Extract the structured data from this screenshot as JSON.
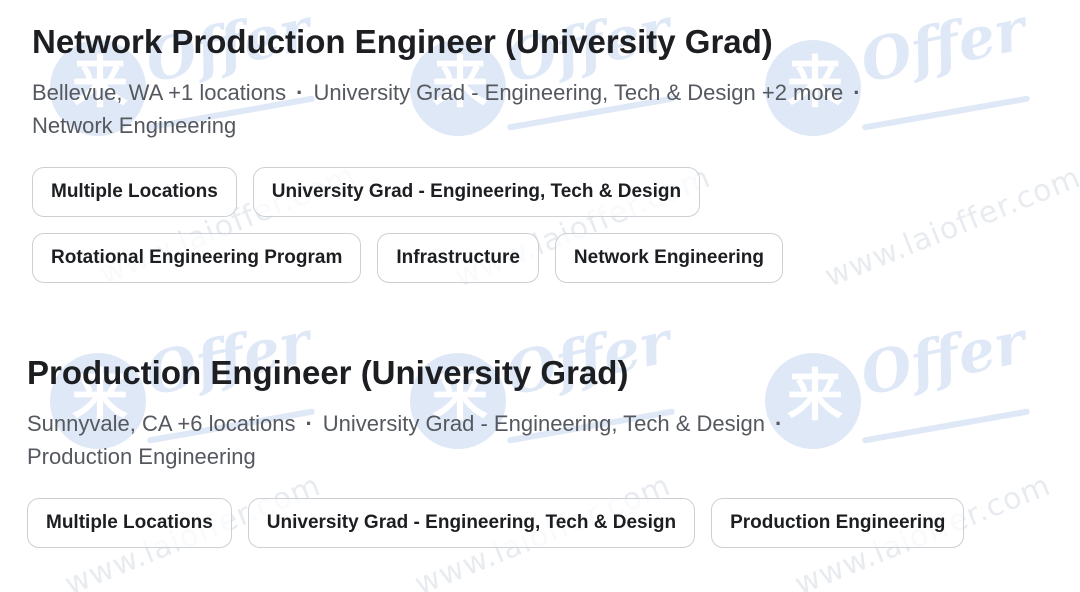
{
  "jobs": [
    {
      "title": "Network Production Engineer (University Grad)",
      "meta": {
        "location": "Bellevue, WA +1 locations",
        "category": "University Grad - Engineering, Tech & Design +2 more",
        "team": "Network Engineering",
        "separator": "·"
      },
      "tags": [
        "Multiple Locations",
        "University Grad - Engineering, Tech & Design",
        "Rotational Engineering Program",
        "Infrastructure",
        "Network Engineering"
      ]
    },
    {
      "title": "Production Engineer (University Grad)",
      "meta": {
        "location": "Sunnyvale, CA +6 locations",
        "category": "University Grad - Engineering, Tech & Design",
        "team": "Production Engineering",
        "separator": "·"
      },
      "tags": [
        "Multiple Locations",
        "University Grad - Engineering, Tech & Design",
        "Production Engineering"
      ]
    }
  ],
  "watermark": {
    "logo_glyph": "来",
    "logo_word": "Offer",
    "url_text": "www.laioffer.com",
    "color": "#3f73c9"
  },
  "colors": {
    "title": "#1c1e21",
    "meta": "#55595f",
    "tag_border": "#ccd0d5",
    "background": "#ffffff"
  }
}
